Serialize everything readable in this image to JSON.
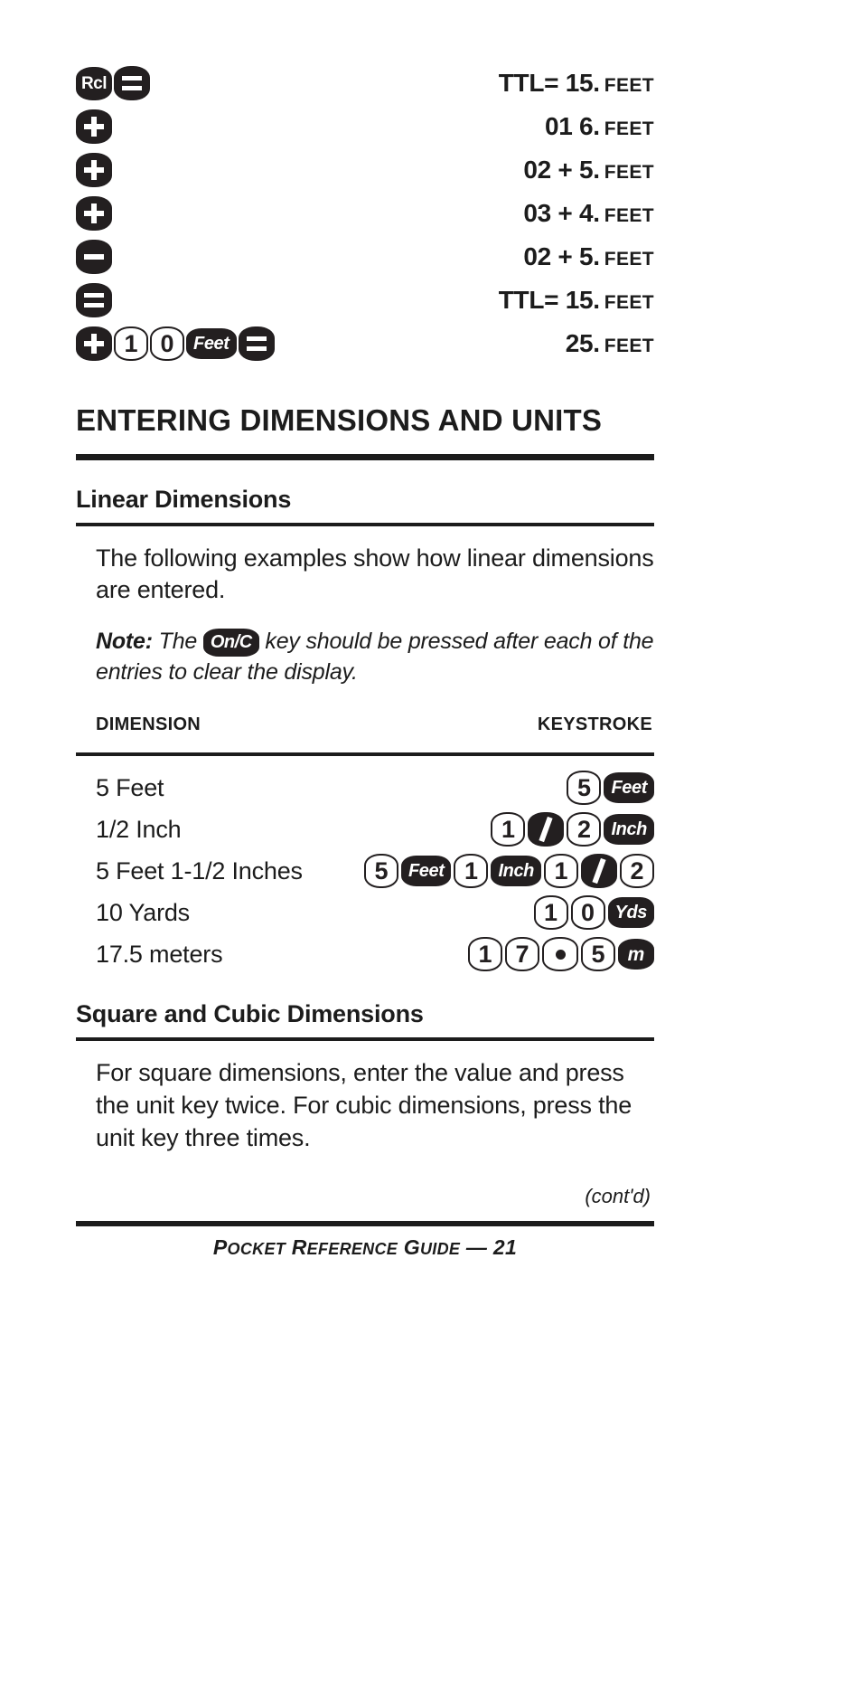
{
  "example_table": {
    "rows": [
      {
        "keys": [
          {
            "type": "word",
            "style": "dark",
            "label": "Rcl"
          },
          {
            "type": "glyph",
            "style": "dark",
            "glyph": "equals",
            "name": "equals-key"
          }
        ],
        "display": "TTL= 15.",
        "unit": "FEET"
      },
      {
        "keys": [
          {
            "type": "glyph",
            "style": "dark",
            "glyph": "plus",
            "name": "plus-key"
          }
        ],
        "display": "01 6.",
        "unit": "FEET"
      },
      {
        "keys": [
          {
            "type": "glyph",
            "style": "dark",
            "glyph": "plus",
            "name": "plus-key"
          }
        ],
        "display": "02 + 5.",
        "unit": "FEET"
      },
      {
        "keys": [
          {
            "type": "glyph",
            "style": "dark",
            "glyph": "plus",
            "name": "plus-key"
          }
        ],
        "display": "03 + 4.",
        "unit": "FEET"
      },
      {
        "keys": [
          {
            "type": "glyph",
            "style": "dark",
            "glyph": "minus",
            "name": "minus-key"
          }
        ],
        "display": "02 + 5.",
        "unit": "FEET"
      },
      {
        "keys": [
          {
            "type": "glyph",
            "style": "dark",
            "glyph": "equals",
            "name": "equals-key"
          }
        ],
        "display": "TTL= 15.",
        "unit": "FEET"
      },
      {
        "keys": [
          {
            "type": "glyph",
            "style": "dark",
            "glyph": "plus",
            "name": "plus-key"
          },
          {
            "type": "num",
            "style": "light",
            "label": "1"
          },
          {
            "type": "num",
            "style": "light",
            "label": "0"
          },
          {
            "type": "word",
            "style": "dark",
            "label": "Feet"
          },
          {
            "type": "glyph",
            "style": "dark",
            "glyph": "equals",
            "name": "equals-key"
          }
        ],
        "display": "25.",
        "unit": "FEET"
      }
    ]
  },
  "chapter": {
    "title": "ENTERING DIMENSIONS AND UNITS"
  },
  "linear": {
    "heading": "Linear Dimensions",
    "paragraph": "The following examples show how linear dimensions are entered.",
    "note_label": "Note:",
    "note_before": " The ",
    "note_key": "On/C",
    "note_after": " key should be pressed after each of the entries to clear the display."
  },
  "dimension_table": {
    "header_left": "DIMENSION",
    "header_right": "KEYSTROKE",
    "rows": [
      {
        "label": "5 Feet",
        "keys": [
          {
            "type": "num",
            "style": "light",
            "label": "5"
          },
          {
            "type": "word",
            "style": "dark",
            "label": "Feet"
          }
        ]
      },
      {
        "label": "1/2 Inch",
        "keys": [
          {
            "type": "num",
            "style": "light",
            "label": "1"
          },
          {
            "type": "glyph",
            "style": "dark",
            "glyph": "slash",
            "name": "divide-key"
          },
          {
            "type": "num",
            "style": "light",
            "label": "2"
          },
          {
            "type": "word",
            "style": "dark",
            "label": "Inch"
          }
        ]
      },
      {
        "label": "5 Feet 1-1/2 Inches",
        "keys": [
          {
            "type": "num",
            "style": "light",
            "label": "5"
          },
          {
            "type": "word",
            "style": "dark",
            "label": "Feet"
          },
          {
            "type": "num",
            "style": "light",
            "label": "1"
          },
          {
            "type": "word",
            "style": "dark",
            "label": "Inch"
          },
          {
            "type": "num",
            "style": "light",
            "label": "1"
          },
          {
            "type": "glyph",
            "style": "dark",
            "glyph": "slash",
            "name": "divide-key"
          },
          {
            "type": "num",
            "style": "light",
            "label": "2"
          }
        ]
      },
      {
        "label": "10 Yards",
        "keys": [
          {
            "type": "num",
            "style": "light",
            "label": "1"
          },
          {
            "type": "num",
            "style": "light",
            "label": "0"
          },
          {
            "type": "word",
            "style": "dark",
            "label": "Yds"
          }
        ]
      },
      {
        "label": "17.5 meters",
        "keys": [
          {
            "type": "num",
            "style": "light",
            "label": "1"
          },
          {
            "type": "num",
            "style": "light",
            "label": "7"
          },
          {
            "type": "glyph",
            "style": "light",
            "glyph": "dot",
            "name": "decimal-point-key"
          },
          {
            "type": "num",
            "style": "light",
            "label": "5"
          },
          {
            "type": "word",
            "style": "dark",
            "label": "m"
          }
        ]
      }
    ]
  },
  "square_cubic": {
    "heading": "Square and Cubic Dimensions",
    "paragraph": "For square dimensions, enter the value and press the unit key twice. For cubic dimensions, press the unit key three times."
  },
  "footer": {
    "contd": "(cont'd)",
    "title_word_1": "P",
    "title_rest_1": "OCKET",
    "title_word_2": "R",
    "title_rest_2": "EFERENCE",
    "title_word_3": "G",
    "title_rest_3": "UIDE",
    "dash": " — ",
    "page_number": "21"
  },
  "colors": {
    "ink": "#1c1c1c",
    "key_dark": "#231f20",
    "paper": "#ffffff"
  }
}
